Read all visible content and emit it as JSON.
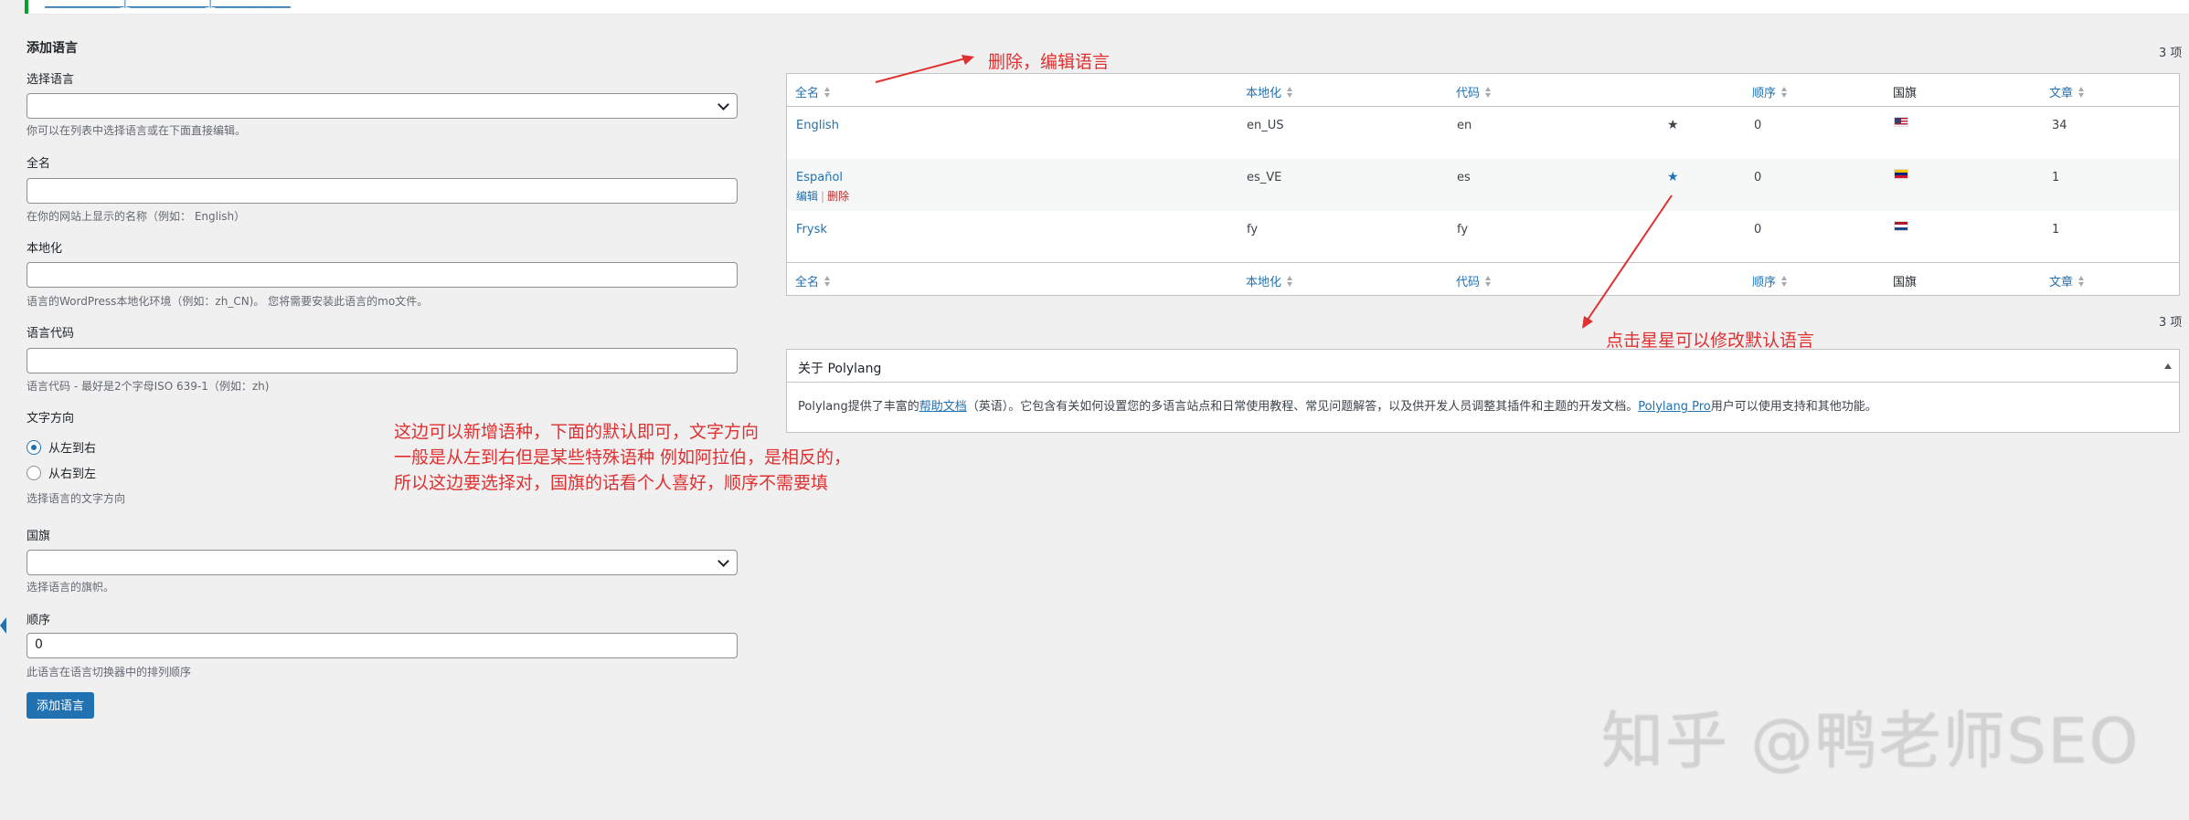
{
  "notice": {
    "links": "_______________ | _______________ | _______________"
  },
  "form": {
    "heading": "添加语言",
    "select_language": {
      "label": "选择语言",
      "value": "",
      "desc": "你可以在列表中选择语言或在下面直接编辑。"
    },
    "full_name": {
      "label": "全名",
      "value": "",
      "desc": "在你的网站上显示的名称（例如： English）"
    },
    "locale": {
      "label": "本地化",
      "value": "",
      "desc": "语言的WordPress本地化环境（例如：zh_CN)。 您将需要安装此语言的mo文件。"
    },
    "code": {
      "label": "语言代码",
      "value": "",
      "desc": "语言代码 - 最好是2个字母ISO 639-1（例如：zh)"
    },
    "direction": {
      "label": "文字方向",
      "ltr": "从左到右",
      "rtl": "从右到左",
      "selected": "ltr",
      "desc": "选择语言的文字方向"
    },
    "flag": {
      "label": "国旗",
      "value": "",
      "desc": "选择语言的旗帜。"
    },
    "order": {
      "label": "顺序",
      "value": "0",
      "desc": "此语言在语言切换器中的排列顺序"
    },
    "submit": "添加语言"
  },
  "table": {
    "count_top": "3 项",
    "count_bottom": "3 项",
    "headers": {
      "name": "全名",
      "locale": "本地化",
      "code": "代码",
      "order": "顺序",
      "flag": "国旗",
      "posts": "文章"
    },
    "rows": [
      {
        "name": "English",
        "locale": "en_US",
        "code": "en",
        "default": true,
        "order": "0",
        "flag": "us",
        "posts": "34"
      },
      {
        "name": "Español",
        "locale": "es_VE",
        "code": "es",
        "default": false,
        "order": "0",
        "flag": "ve",
        "posts": "1",
        "edit": "编辑",
        "delete": "删除"
      },
      {
        "name": "Frysk",
        "locale": "fy",
        "code": "fy",
        "default": false,
        "order": "0",
        "flag": "nl",
        "posts": "1"
      }
    ]
  },
  "about": {
    "title": "关于 Polylang",
    "text_a": "Polylang提供了丰富的",
    "link_docs": "帮助文档",
    "text_b": "（英语）。它包含有关如何设置您的多语言站点和日常使用教程、常见问题解答，以及供开发人员调整其插件和主题的开发文档。",
    "link_pro": "Polylang Pro",
    "text_c": "用户可以使用支持和其他功能。"
  },
  "annotations": {
    "delete_edit": "删除，编辑语言",
    "star_default": "点击星星可以修改默认语言",
    "note_line1": "这边可以新增语种，下面的默认即可，文字方向",
    "note_line2": "一般是从左到右但是某些特殊语种 例如阿拉伯，是相反的，",
    "note_line3": "所以这边要选择对，国旗的话看个人喜好，顺序不需要填"
  },
  "watermark": "知乎 @鸭老师SEO",
  "colors": {
    "accent": "#2271b1",
    "annotation": "#e03030",
    "delete": "#b32d2e",
    "notice": "#00a32a"
  }
}
